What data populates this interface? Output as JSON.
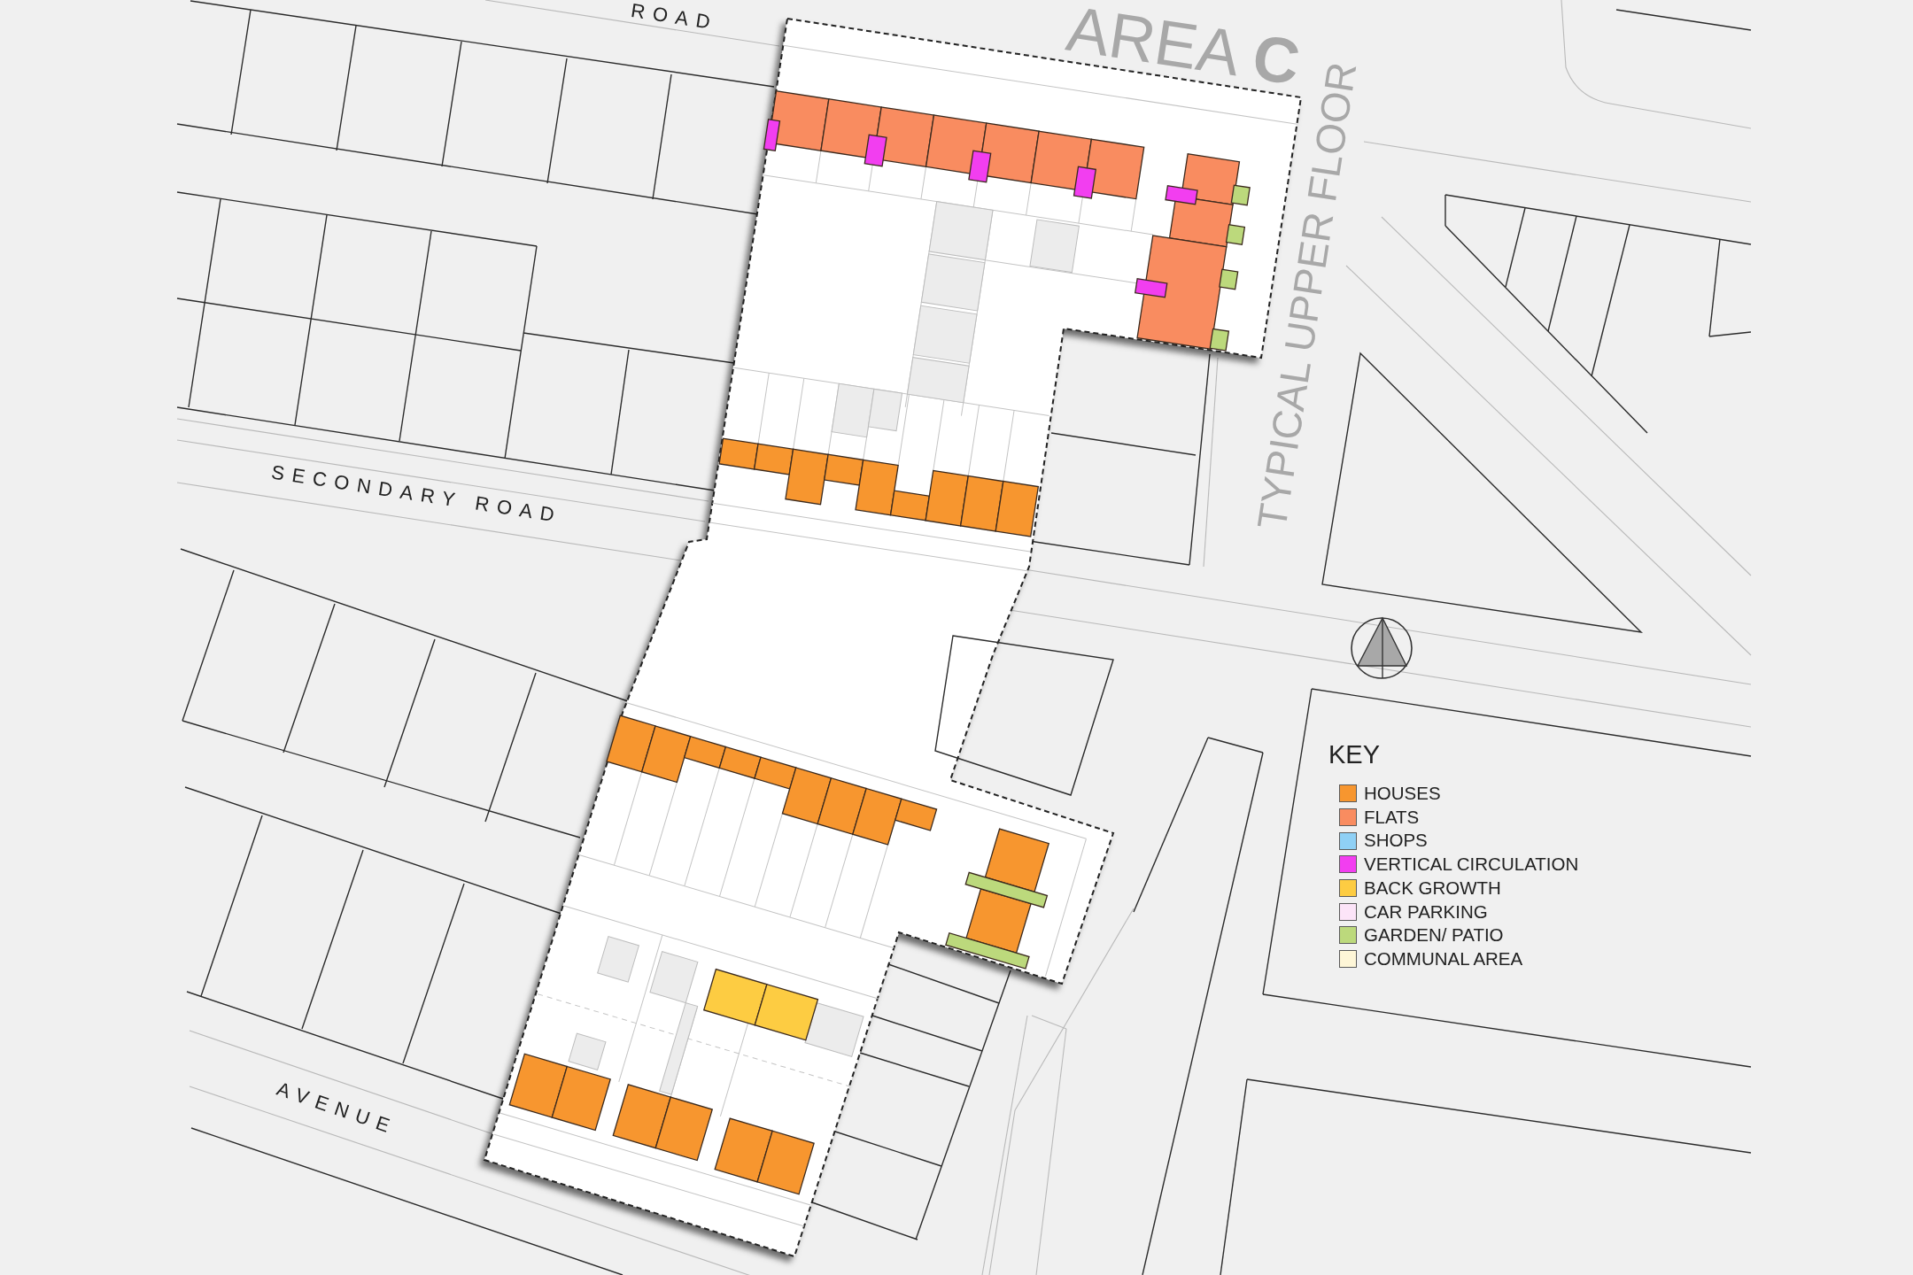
{
  "map": {
    "road_labels": [
      "ROAD",
      "SECONDARY ROAD",
      "AVENUE"
    ],
    "area_title": "AREA **C**",
    "floor_label": "TYPICAL UPPER FLOOR"
  },
  "key": {
    "title": "KEY",
    "items": [
      {
        "label": "HOUSES",
        "color": "#f7962f"
      },
      {
        "label": "FLATS",
        "color": "#f98c60"
      },
      {
        "label": "SHOPS",
        "color": "#8fd0f5"
      },
      {
        "label": "VERTICAL CIRCULATION",
        "color": "#f23ef0"
      },
      {
        "label": "BACK GROWTH",
        "color": "#fdcc42"
      },
      {
        "label": "CAR PARKING",
        "color": "#fce4f8"
      },
      {
        "label": "GARDEN/ PATIO",
        "color": "#bcd97c"
      },
      {
        "label": "COMMUNAL AREA",
        "color": "#fef6d7"
      }
    ]
  }
}
